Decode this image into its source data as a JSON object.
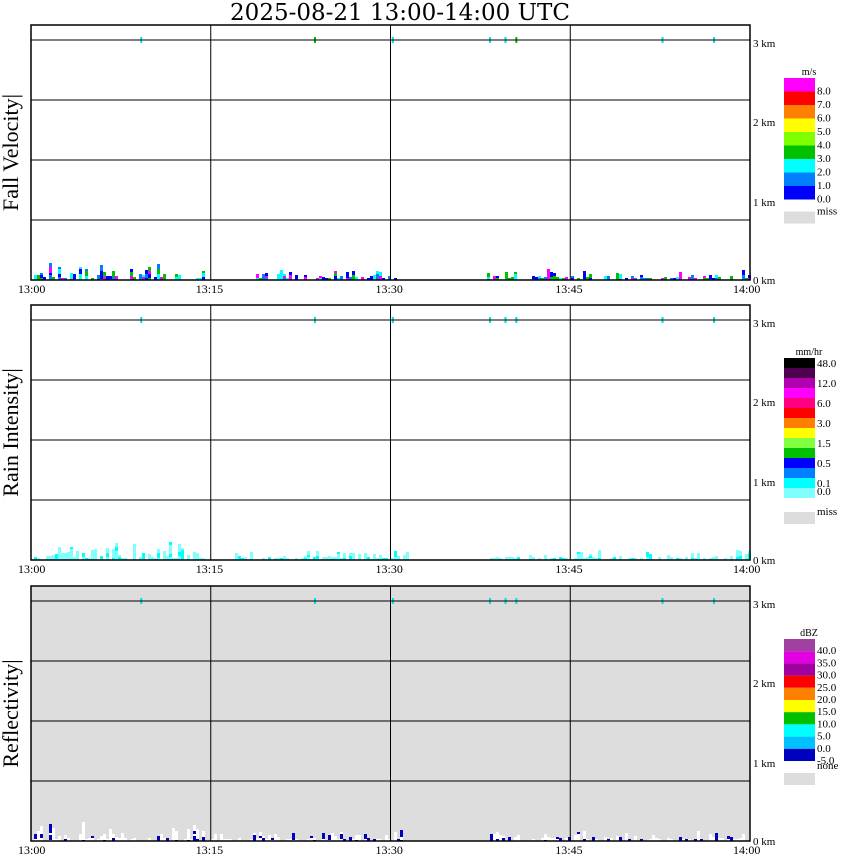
{
  "title": "2025-08-21   13:00-14:00 UTC",
  "chart_data": [
    {
      "type": "heatmap",
      "ylabel": "Fall Velocity",
      "xticks": [
        "13:00",
        "13:15",
        "13:30",
        "13:45",
        "14:00"
      ],
      "xlim_minutes": [
        0,
        60
      ],
      "yticks": [
        "0 km",
        "1 km",
        "2 km",
        "3 km"
      ],
      "legend": {
        "unit": "m/s",
        "labels": [
          "8.0",
          "7.0",
          "6.0",
          "5.0",
          "4.0",
          "3.0",
          "2.0",
          "1.0",
          "0.0"
        ],
        "colors": [
          "#ff00ff",
          "#ff0000",
          "#ff8000",
          "#ffff00",
          "#80ff00",
          "#00c000",
          "#00ffff",
          "#0080ff",
          "#0000ff"
        ],
        "miss_label": "miss",
        "miss_color": "#dddddd"
      },
      "background": "#ffffff",
      "echo_colors": [
        "#ff00ff",
        "#0000ff",
        "#0080ff",
        "#00ffff",
        "#00c000"
      ],
      "echo_windows": [
        [
          0,
          14.5
        ],
        [
          18.5,
          31.5
        ],
        [
          38,
          60
        ]
      ],
      "top_marks_minutes": [
        9.2,
        23.7,
        30.2,
        38.3,
        39.6,
        40.5,
        52.7,
        57
      ]
    },
    {
      "type": "heatmap",
      "ylabel": "Rain Intensity",
      "xticks": [
        "13:00",
        "13:15",
        "13:30",
        "13:45",
        "14:00"
      ],
      "xlim_minutes": [
        0,
        60
      ],
      "yticks": [
        "0 km",
        "1 km",
        "2 km",
        "3 km"
      ],
      "legend": {
        "unit": "mm/hr",
        "labels": [
          "48.0",
          "",
          "12.0",
          "",
          "6.0",
          "",
          "3.0",
          "",
          "1.5",
          "",
          "0.5",
          "",
          "0.1",
          "0.0"
        ],
        "colors": [
          "#000000",
          "#500050",
          "#b000b0",
          "#ff00ff",
          "#ff0080",
          "#ff0000",
          "#ff8000",
          "#ffff00",
          "#80ff40",
          "#00c000",
          "#0000ff",
          "#0080ff",
          "#00ffff",
          "#80ffff"
        ],
        "miss_label": "miss",
        "miss_color": "#dddddd"
      },
      "background": "#ffffff",
      "echo_colors": [
        "#80ffff",
        "#80ffff",
        "#80ffff",
        "#00ffff"
      ],
      "echo_windows": [
        [
          0,
          14.5
        ],
        [
          17,
          31.5
        ],
        [
          38,
          60
        ]
      ],
      "top_marks_minutes": [
        9.2,
        23.7,
        30.2,
        38.3,
        39.6,
        40.5,
        52.7,
        57
      ]
    },
    {
      "type": "heatmap",
      "ylabel": "Reflectivity",
      "xticks": [
        "13:00",
        "13:15",
        "13:30",
        "13:45",
        "14:00"
      ],
      "xlim_minutes": [
        0,
        60
      ],
      "yticks": [
        "0 km",
        "1 km",
        "2 km",
        "3 km"
      ],
      "legend": {
        "unit": "dBZ",
        "labels": [
          "40.0",
          "35.0",
          "30.0",
          "25.0",
          "20.0",
          "15.0",
          "10.0",
          "5.0",
          "0.0",
          "-5.0"
        ],
        "colors": [
          "#a040a0",
          "#e000e0",
          "#a000a0",
          "#ff0000",
          "#ff8000",
          "#ffff00",
          "#00c000",
          "#00ffff",
          "#00c0ff",
          "#0000c0"
        ],
        "miss_label": "none",
        "miss_color": "#dddddd"
      },
      "background": "#dddddd",
      "echo_colors": [
        "#ffffff",
        "#ffffff",
        "#ffffff",
        "#0000c0"
      ],
      "echo_windows": [
        [
          0,
          14.5
        ],
        [
          15,
          31.5
        ],
        [
          38,
          60
        ]
      ],
      "top_marks_minutes": [
        9.2,
        23.7,
        30.2,
        38.3,
        39.6,
        40.5,
        52.7,
        57
      ]
    }
  ]
}
